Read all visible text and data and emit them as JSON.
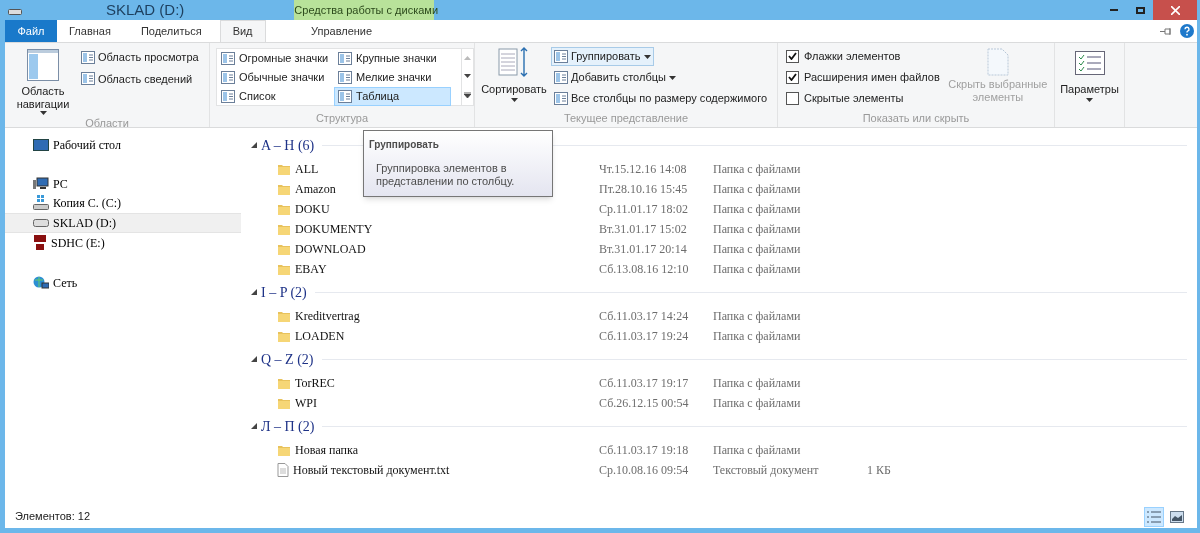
{
  "window": {
    "title": "SKLAD (D:)",
    "context_group": "Средства работы с дисками"
  },
  "tabs": [
    {
      "label": "Файл",
      "kind": "file",
      "selected": false
    },
    {
      "label": "Главная",
      "kind": "normal",
      "selected": false
    },
    {
      "label": "Поделиться",
      "kind": "normal",
      "selected": false
    },
    {
      "label": "Вид",
      "kind": "normal",
      "selected": true
    },
    {
      "label": "Управление",
      "kind": "context",
      "selected": false
    }
  ],
  "ribbon": {
    "panes": {
      "label": "Области",
      "nav_button": "Область навигации",
      "items": [
        "Область просмотра",
        "Область сведений"
      ]
    },
    "layout": {
      "label": "Структура",
      "items": [
        {
          "label": "Огромные значки",
          "selected": false
        },
        {
          "label": "Крупные значки",
          "selected": false
        },
        {
          "label": "Обычные значки",
          "selected": false
        },
        {
          "label": "Мелкие значки",
          "selected": false
        },
        {
          "label": "Список",
          "selected": false
        },
        {
          "label": "Таблица",
          "selected": true
        }
      ]
    },
    "current_view": {
      "label": "Текущее представление",
      "sort_button": "Сортировать",
      "items": [
        {
          "label": "Группировать",
          "dropdown": true,
          "selected": true
        },
        {
          "label": "Добавить столбцы",
          "dropdown": true,
          "selected": false
        },
        {
          "label": "Все столбцы по размеру содержимого",
          "dropdown": false,
          "selected": false
        }
      ]
    },
    "show_hide": {
      "label": "Показать или скрыть",
      "checkboxes": [
        {
          "label": "Флажки элементов",
          "checked": true
        },
        {
          "label": "Расширения имен файлов",
          "checked": true
        },
        {
          "label": "Скрытые элементы",
          "checked": false
        }
      ],
      "hide_button": {
        "label": "Скрыть выбранные элементы",
        "disabled": true
      }
    },
    "options": {
      "label": "Параметры"
    }
  },
  "nav": [
    {
      "label": "Рабочий стол",
      "kind": "desktop",
      "selected": false
    },
    {
      "label": "PC",
      "kind": "pc",
      "selected": false,
      "children": [
        {
          "label": "Копия C. (C:)",
          "kind": "system",
          "selected": false
        },
        {
          "label": "SKLAD (D:)",
          "kind": "drive",
          "selected": true
        },
        {
          "label": "SDHC (E:)",
          "kind": "sd",
          "selected": false
        }
      ]
    },
    {
      "label": "Сеть",
      "kind": "network",
      "selected": false
    }
  ],
  "groups": [
    {
      "header": "A – H (6)",
      "expanded": true,
      "files": [
        {
          "name": "ALL",
          "kind": "folder",
          "date": "Чт.15.12.16 14:08",
          "type": "Папка с файлами"
        },
        {
          "name": "Amazon",
          "kind": "folder",
          "date": "Пт.28.10.16 15:45",
          "type": "Папка с файлами"
        },
        {
          "name": "DOKU",
          "kind": "folder",
          "date": "Ср.11.01.17 18:02",
          "type": "Папка с файлами"
        },
        {
          "name": "DOKUMENTY",
          "kind": "folder",
          "date": "Вт.31.01.17 15:02",
          "type": "Папка с файлами"
        },
        {
          "name": "DOWNLOAD",
          "kind": "folder",
          "date": "Вт.31.01.17 20:14",
          "type": "Папка с файлами"
        },
        {
          "name": "EBAY",
          "kind": "folder",
          "date": "Сб.13.08.16 12:10",
          "type": "Папка с файлами"
        }
      ]
    },
    {
      "header": "I – P (2)",
      "expanded": true,
      "files": [
        {
          "name": "Kreditvertrag",
          "kind": "folder",
          "date": "Сб.11.03.17 14:24",
          "type": "Папка с файлами"
        },
        {
          "name": "LOADEN",
          "kind": "folder",
          "date": "Сб.11.03.17 19:24",
          "type": "Папка с файлами"
        }
      ]
    },
    {
      "header": "Q – Z (2)",
      "expanded": true,
      "files": [
        {
          "name": "TorREC",
          "kind": "folder",
          "date": "Сб.11.03.17 19:17",
          "type": "Папка с файлами"
        },
        {
          "name": "WPI",
          "kind": "folder",
          "date": "Сб.26.12.15 00:54",
          "type": "Папка с файлами"
        }
      ]
    },
    {
      "header": "Л – П (2)",
      "expanded": true,
      "files": [
        {
          "name": "Новая папка",
          "kind": "folder",
          "date": "Сб.11.03.17 19:18",
          "type": "Папка с файлами"
        },
        {
          "name": "Новый текстовый документ.txt",
          "kind": "text",
          "date": "Ср.10.08.16 09:54",
          "type": "Текстовый документ",
          "size": "1 КБ"
        }
      ]
    }
  ],
  "tooltip": {
    "title": "Группировать",
    "text": "Группировка элементов в представлении по столбцу."
  },
  "status_bar": {
    "count": "Элементов: 12",
    "views": [
      {
        "kind": "details",
        "selected": true
      },
      {
        "kind": "tiles",
        "selected": false
      }
    ]
  }
}
